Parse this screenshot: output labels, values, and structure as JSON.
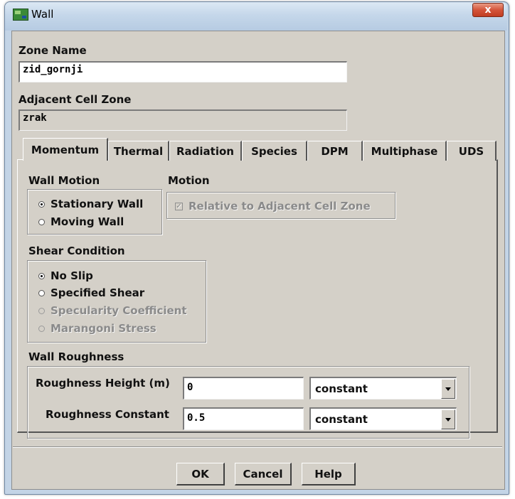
{
  "window": {
    "title": "Wall",
    "close_glyph": "x"
  },
  "zone_name": {
    "label": "Zone Name",
    "value": "zid_gornji"
  },
  "adjacent_cell_zone": {
    "label": "Adjacent Cell Zone",
    "value": "zrak"
  },
  "tabs": [
    {
      "label": "Momentum",
      "active": true
    },
    {
      "label": "Thermal"
    },
    {
      "label": "Radiation"
    },
    {
      "label": "Species"
    },
    {
      "label": "DPM"
    },
    {
      "label": "Multiphase"
    },
    {
      "label": "UDS"
    }
  ],
  "wall_motion": {
    "label": "Wall Motion",
    "options": [
      {
        "label": "Stationary Wall",
        "selected": true
      },
      {
        "label": "Moving Wall",
        "selected": false
      }
    ]
  },
  "motion": {
    "label": "Motion",
    "relative_checkbox": {
      "label": "Relative to Adjacent Cell Zone",
      "checked": true,
      "disabled": true
    }
  },
  "shear_condition": {
    "label": "Shear Condition",
    "options": [
      {
        "label": "No Slip",
        "selected": true
      },
      {
        "label": "Specified Shear",
        "selected": false
      },
      {
        "label": "Specularity Coefficient",
        "disabled": true
      },
      {
        "label": "Marangoni Stress",
        "disabled": true
      }
    ]
  },
  "wall_roughness": {
    "label": "Wall Roughness",
    "height": {
      "label": "Roughness Height (m)",
      "value": "0",
      "method": "constant"
    },
    "constant": {
      "label": "Roughness Constant",
      "value": "0.5",
      "method": "constant"
    }
  },
  "buttons": {
    "ok": "OK",
    "cancel": "Cancel",
    "help": "Help"
  },
  "colors": {
    "dialog_bg": "#d4d0c8",
    "titlebar": "#c5d7ea",
    "close": "#c13d22"
  }
}
